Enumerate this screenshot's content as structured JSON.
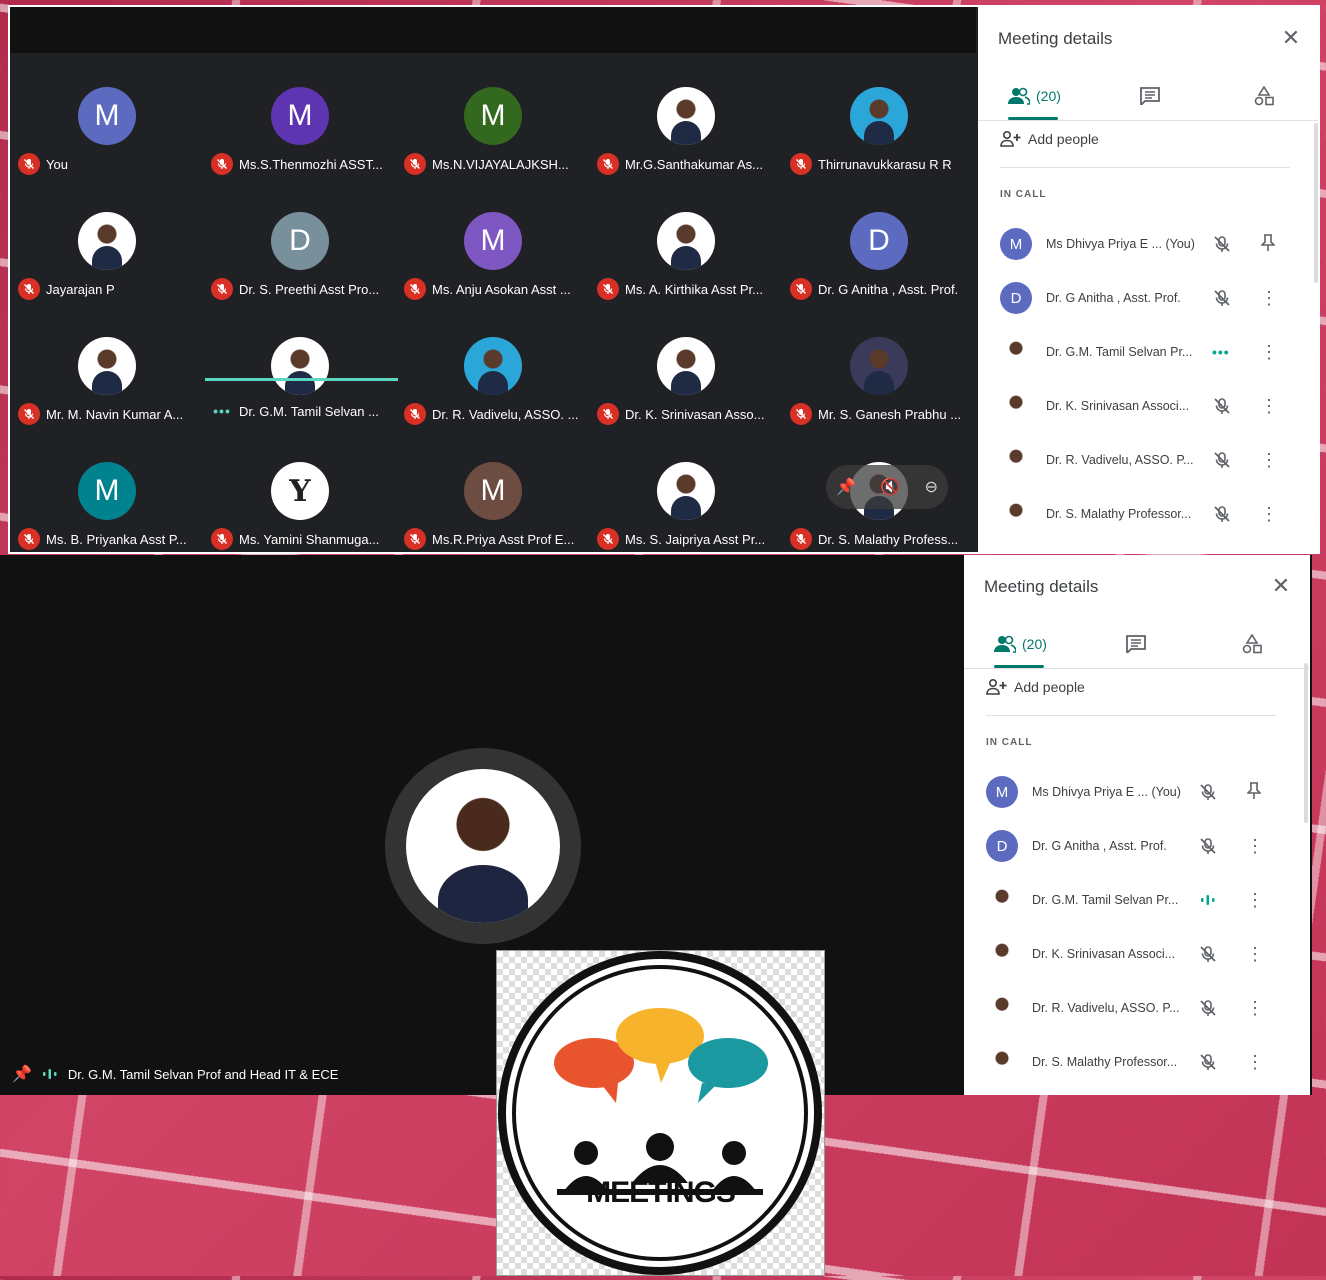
{
  "top_grid": {
    "tiles": [
      {
        "initial": "M",
        "color": "#5c6bc0",
        "name": "You",
        "status": "muted"
      },
      {
        "initial": "M",
        "color": "#5e35b1",
        "name": "Ms.S.Thenmozhi ASST...",
        "status": "muted"
      },
      {
        "initial": "M",
        "color": "#33691e",
        "name": "Ms.N.VIJAYALAJKSH...",
        "status": "muted"
      },
      {
        "initial": "",
        "color": "",
        "name": "Mr.G.Santhakumar As...",
        "status": "muted"
      },
      {
        "initial": "",
        "color": "",
        "name": "Thirrunavukkarasu R R",
        "status": "muted"
      },
      {
        "initial": "",
        "color": "",
        "name": "Jayarajan P",
        "status": "muted"
      },
      {
        "initial": "D",
        "color": "#78909c",
        "name": "Dr. S. Preethi Asst Pro...",
        "status": "muted"
      },
      {
        "initial": "M",
        "color": "#7e57c2",
        "name": "Ms. Anju Asokan Asst ...",
        "status": "muted"
      },
      {
        "initial": "",
        "color": "",
        "name": "Ms. A. Kirthika Asst Pr...",
        "status": "muted"
      },
      {
        "initial": "D",
        "color": "#5c6bc0",
        "name": "Dr. G Anitha , Asst. Prof.",
        "status": "muted"
      },
      {
        "initial": "",
        "color": "",
        "name": "Mr. M. Navin Kumar A...",
        "status": "muted"
      },
      {
        "initial": "",
        "color": "",
        "name": "Dr. G.M. Tamil Selvan ...",
        "status": "speaking"
      },
      {
        "initial": "",
        "color": "",
        "name": "Dr. R. Vadivelu, ASSO. ...",
        "status": "muted"
      },
      {
        "initial": "",
        "color": "",
        "name": "Dr. K. Srinivasan Asso...",
        "status": "muted"
      },
      {
        "initial": "",
        "color": "",
        "name": "Mr. S. Ganesh Prabhu ...",
        "status": "muted"
      },
      {
        "initial": "M",
        "color": "#00838f",
        "name": "Ms. B. Priyanka Asst P...",
        "status": "muted"
      },
      {
        "initial": "Y",
        "color": "#ffffff",
        "name": "Ms. Yamini Shanmuga...",
        "status": "muted"
      },
      {
        "initial": "M",
        "color": "#6d4c41",
        "name": "Ms.R.Priya Asst Prof E...",
        "status": "muted"
      },
      {
        "initial": "",
        "color": "",
        "name": "Ms. S. Jaipriya Asst Pr...",
        "status": "muted"
      },
      {
        "initial": "",
        "color": "",
        "name": "Dr. S. Malathy Profess...",
        "status": "muted"
      }
    ]
  },
  "panel": {
    "title": "Meeting details",
    "people_tab": "(20)",
    "add_people": "Add people",
    "in_call": "IN CALL",
    "people": [
      {
        "initial": "M",
        "color": "#5c6bc0",
        "name": "Ms Dhivya Priya E ... (You)",
        "status": "muted",
        "action": "pin"
      },
      {
        "initial": "D",
        "color": "#5c6bc0",
        "name": "Dr. G Anitha , Asst. Prof.",
        "status": "muted",
        "action": "more"
      },
      {
        "initial": "",
        "color": "",
        "name": "Dr. G.M. Tamil Selvan Pr...",
        "status": "speaking",
        "action": "more"
      },
      {
        "initial": "",
        "color": "",
        "name": "Dr. K. Srinivasan Associ...",
        "status": "muted",
        "action": "more"
      },
      {
        "initial": "",
        "color": "",
        "name": "Dr. R. Vadivelu, ASSO. P...",
        "status": "muted",
        "action": "more"
      },
      {
        "initial": "",
        "color": "",
        "name": "Dr. S. Malathy Professor...",
        "status": "muted",
        "action": "more"
      }
    ]
  },
  "spotlight": {
    "name": "Dr. G.M. Tamil Selvan Prof and Head IT & ECE"
  },
  "logo": {
    "text": "MEETINGS",
    "bubble_colors": [
      "#e8542e",
      "#f7b32b",
      "#1a9aa0"
    ]
  }
}
